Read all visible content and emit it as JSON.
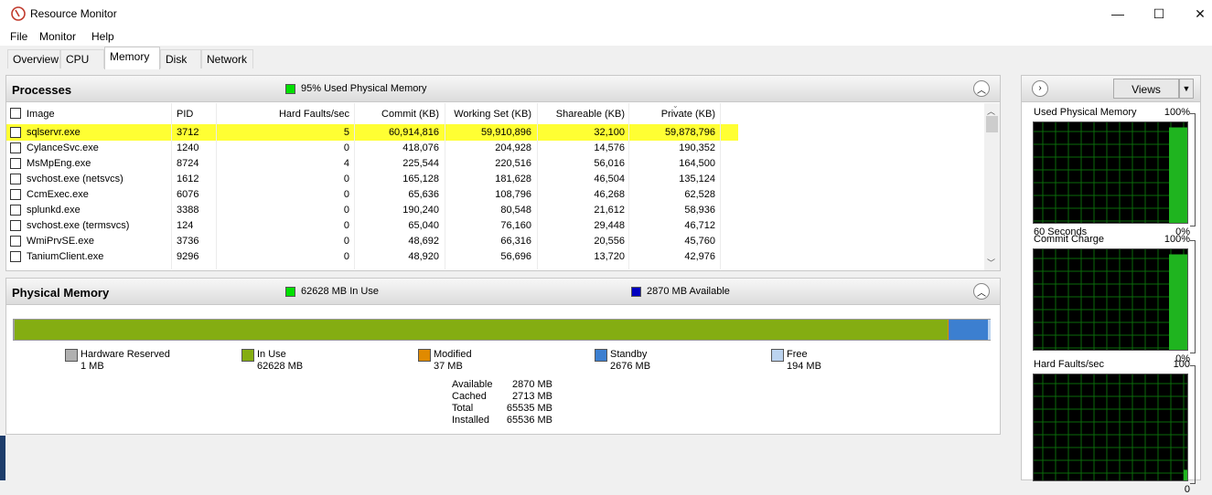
{
  "window": {
    "title": "Resource Monitor",
    "minimize_icon": "—",
    "maximize_icon": "☐",
    "close_icon": "✕"
  },
  "menu": [
    "File",
    "Monitor",
    "Help"
  ],
  "tabs": [
    {
      "label": "Overview",
      "active": false
    },
    {
      "label": "CPU",
      "active": false
    },
    {
      "label": "Memory",
      "active": true
    },
    {
      "label": "Disk",
      "active": false
    },
    {
      "label": "Network",
      "active": false
    }
  ],
  "processes": {
    "title": "Processes",
    "summary": "95% Used Physical Memory",
    "summary_color": "#00e000",
    "columns": [
      "Image",
      "PID",
      "Hard Faults/sec",
      "Commit (KB)",
      "Working Set (KB)",
      "Shareable (KB)",
      "Private (KB)"
    ],
    "rows": [
      {
        "image": "sqlservr.exe",
        "pid": "3712",
        "hard_faults": "5",
        "commit": "60,914,816",
        "working_set": "59,910,896",
        "shareable": "32,100",
        "private": "59,878,796"
      },
      {
        "image": "CylanceSvc.exe",
        "pid": "1240",
        "hard_faults": "0",
        "commit": "418,076",
        "working_set": "204,928",
        "shareable": "14,576",
        "private": "190,352"
      },
      {
        "image": "MsMpEng.exe",
        "pid": "8724",
        "hard_faults": "4",
        "commit": "225,544",
        "working_set": "220,516",
        "shareable": "56,016",
        "private": "164,500"
      },
      {
        "image": "svchost.exe (netsvcs)",
        "pid": "1612",
        "hard_faults": "0",
        "commit": "165,128",
        "working_set": "181,628",
        "shareable": "46,504",
        "private": "135,124"
      },
      {
        "image": "CcmExec.exe",
        "pid": "6076",
        "hard_faults": "0",
        "commit": "65,636",
        "working_set": "108,796",
        "shareable": "46,268",
        "private": "62,528"
      },
      {
        "image": "splunkd.exe",
        "pid": "3388",
        "hard_faults": "0",
        "commit": "190,240",
        "working_set": "80,548",
        "shareable": "21,612",
        "private": "58,936"
      },
      {
        "image": "svchost.exe (termsvcs)",
        "pid": "124",
        "hard_faults": "0",
        "commit": "65,040",
        "working_set": "76,160",
        "shareable": "29,448",
        "private": "46,712"
      },
      {
        "image": "WmiPrvSE.exe",
        "pid": "3736",
        "hard_faults": "0",
        "commit": "48,692",
        "working_set": "66,316",
        "shareable": "20,556",
        "private": "45,760"
      },
      {
        "image": "TaniumClient.exe",
        "pid": "9296",
        "hard_faults": "0",
        "commit": "48,920",
        "working_set": "56,696",
        "shareable": "13,720",
        "private": "42,976"
      }
    ],
    "highlight_color": "#ffff33"
  },
  "physical_memory": {
    "title": "Physical Memory",
    "in_use_summary": "62628 MB In Use",
    "in_use_color": "#00e000",
    "available_summary": "2870 MB Available",
    "available_color": "#0000c0",
    "bar": [
      {
        "name": "Hardware Reserved",
        "mb": 1,
        "color": "#a0a0a0"
      },
      {
        "name": "In Use",
        "mb": 62628,
        "color": "#84ad12"
      },
      {
        "name": "Modified",
        "mb": 37,
        "color": "#e08a00"
      },
      {
        "name": "Standby",
        "mb": 2676,
        "color": "#3c7fd0"
      },
      {
        "name": "Free",
        "mb": 194,
        "color": "#bcd4f0"
      }
    ],
    "legend": [
      {
        "label": "Hardware Reserved",
        "value": "1 MB",
        "color": "#b0b0b0"
      },
      {
        "label": "In Use",
        "value": "62628 MB",
        "color": "#84ad12"
      },
      {
        "label": "Modified",
        "value": "37 MB",
        "color": "#e08a00"
      },
      {
        "label": "Standby",
        "value": "2676 MB",
        "color": "#3c7fd0"
      },
      {
        "label": "Free",
        "value": "194 MB",
        "color": "#bcd4f0"
      }
    ],
    "summary": [
      {
        "key": "Available",
        "value": "2870 MB"
      },
      {
        "key": "Cached",
        "value": "2713 MB"
      },
      {
        "key": "Total",
        "value": "65535 MB"
      },
      {
        "key": "Installed",
        "value": "65536 MB"
      }
    ]
  },
  "right_pane": {
    "views_label": "Views",
    "graphs": [
      {
        "title": "Used Physical Memory",
        "max": "100%",
        "min": "0%",
        "footer": "60 Seconds",
        "level": 0.95
      },
      {
        "title": "Commit Charge",
        "max": "100%",
        "min": "0%",
        "footer": "",
        "level": 0.95
      },
      {
        "title": "Hard Faults/sec",
        "max": "100",
        "min": "0",
        "footer": "",
        "level": 0.1
      }
    ]
  }
}
